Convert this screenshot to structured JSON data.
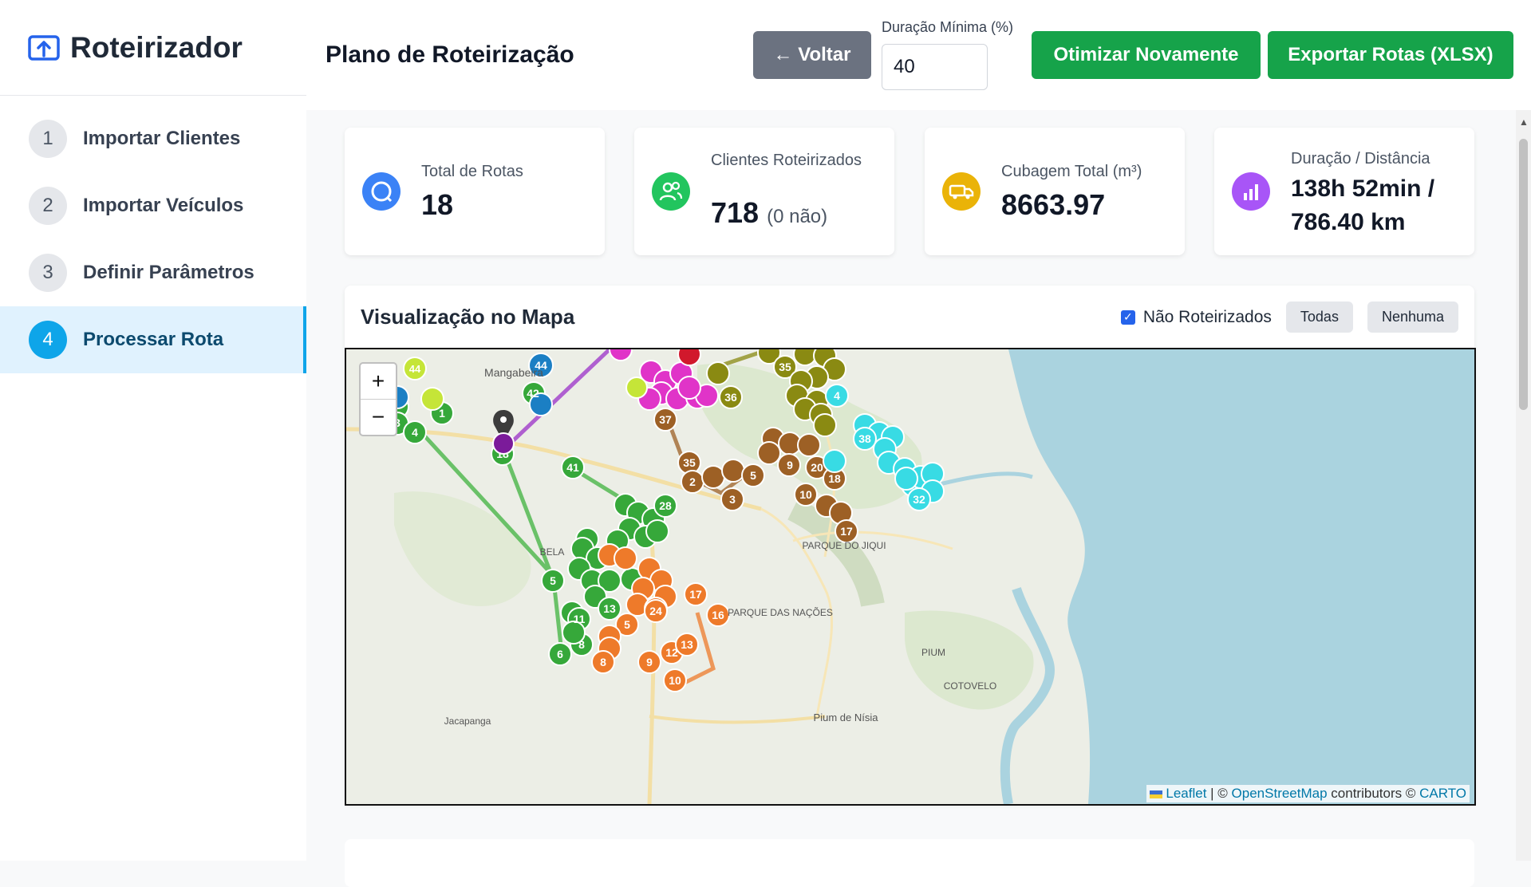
{
  "app": {
    "title": "Roteirizador",
    "icon": "upload-box-icon"
  },
  "sidebar": {
    "items": [
      {
        "num": "1",
        "label": "Importar Clientes"
      },
      {
        "num": "2",
        "label": "Importar Veículos"
      },
      {
        "num": "3",
        "label": "Definir Parâmetros"
      },
      {
        "num": "4",
        "label": "Processar Rota"
      }
    ],
    "active_index": 3
  },
  "header": {
    "title": "Plano de Roteirização",
    "back_label": "← Voltar",
    "duration_label": "Duração Mínima (%)",
    "duration_value": "40",
    "optimize_label": "Otimizar Novamente",
    "export_label": "Exportar Rotas (XLSX)"
  },
  "stats": [
    {
      "label": "Total de Rotas",
      "value": "18",
      "icon": "search-icon",
      "color": "#3b82f6"
    },
    {
      "label": "Clientes Roteirizados",
      "value": "718",
      "sub": "(0 não)",
      "icon": "users-icon",
      "color": "#22c55e"
    },
    {
      "label": "Cubagem Total (m³)",
      "value": "8663.97",
      "icon": "truck-icon",
      "color": "#eab308"
    },
    {
      "label": "Duração / Distância",
      "value": "138h 52min / 786.40 km",
      "icon": "bar-chart-icon",
      "color": "#a855f7"
    }
  ],
  "map_section": {
    "title": "Visualização no Mapa",
    "checkbox_label": "Não Roteirizados",
    "all_label": "Todas",
    "none_label": "Nenhuma",
    "zoom_in": "+",
    "zoom_out": "−",
    "attribution": {
      "leaflet": "Leaflet",
      "osm": "OpenStreetMap",
      "contributors": "contributors ©",
      "carto": "CARTO"
    },
    "place_labels": [
      "Mangabeira",
      "BELA",
      "PARQUE DO JIQUI",
      "PARQUE DAS NAÇÕES",
      "PIUM",
      "COTOVELO",
      "Pium de Nísia",
      "Jacapanga"
    ]
  },
  "colors": {
    "primary": "#16a34a",
    "active": "#0ea5e9",
    "back": "#6b7280",
    "sea": "#aad3df"
  }
}
